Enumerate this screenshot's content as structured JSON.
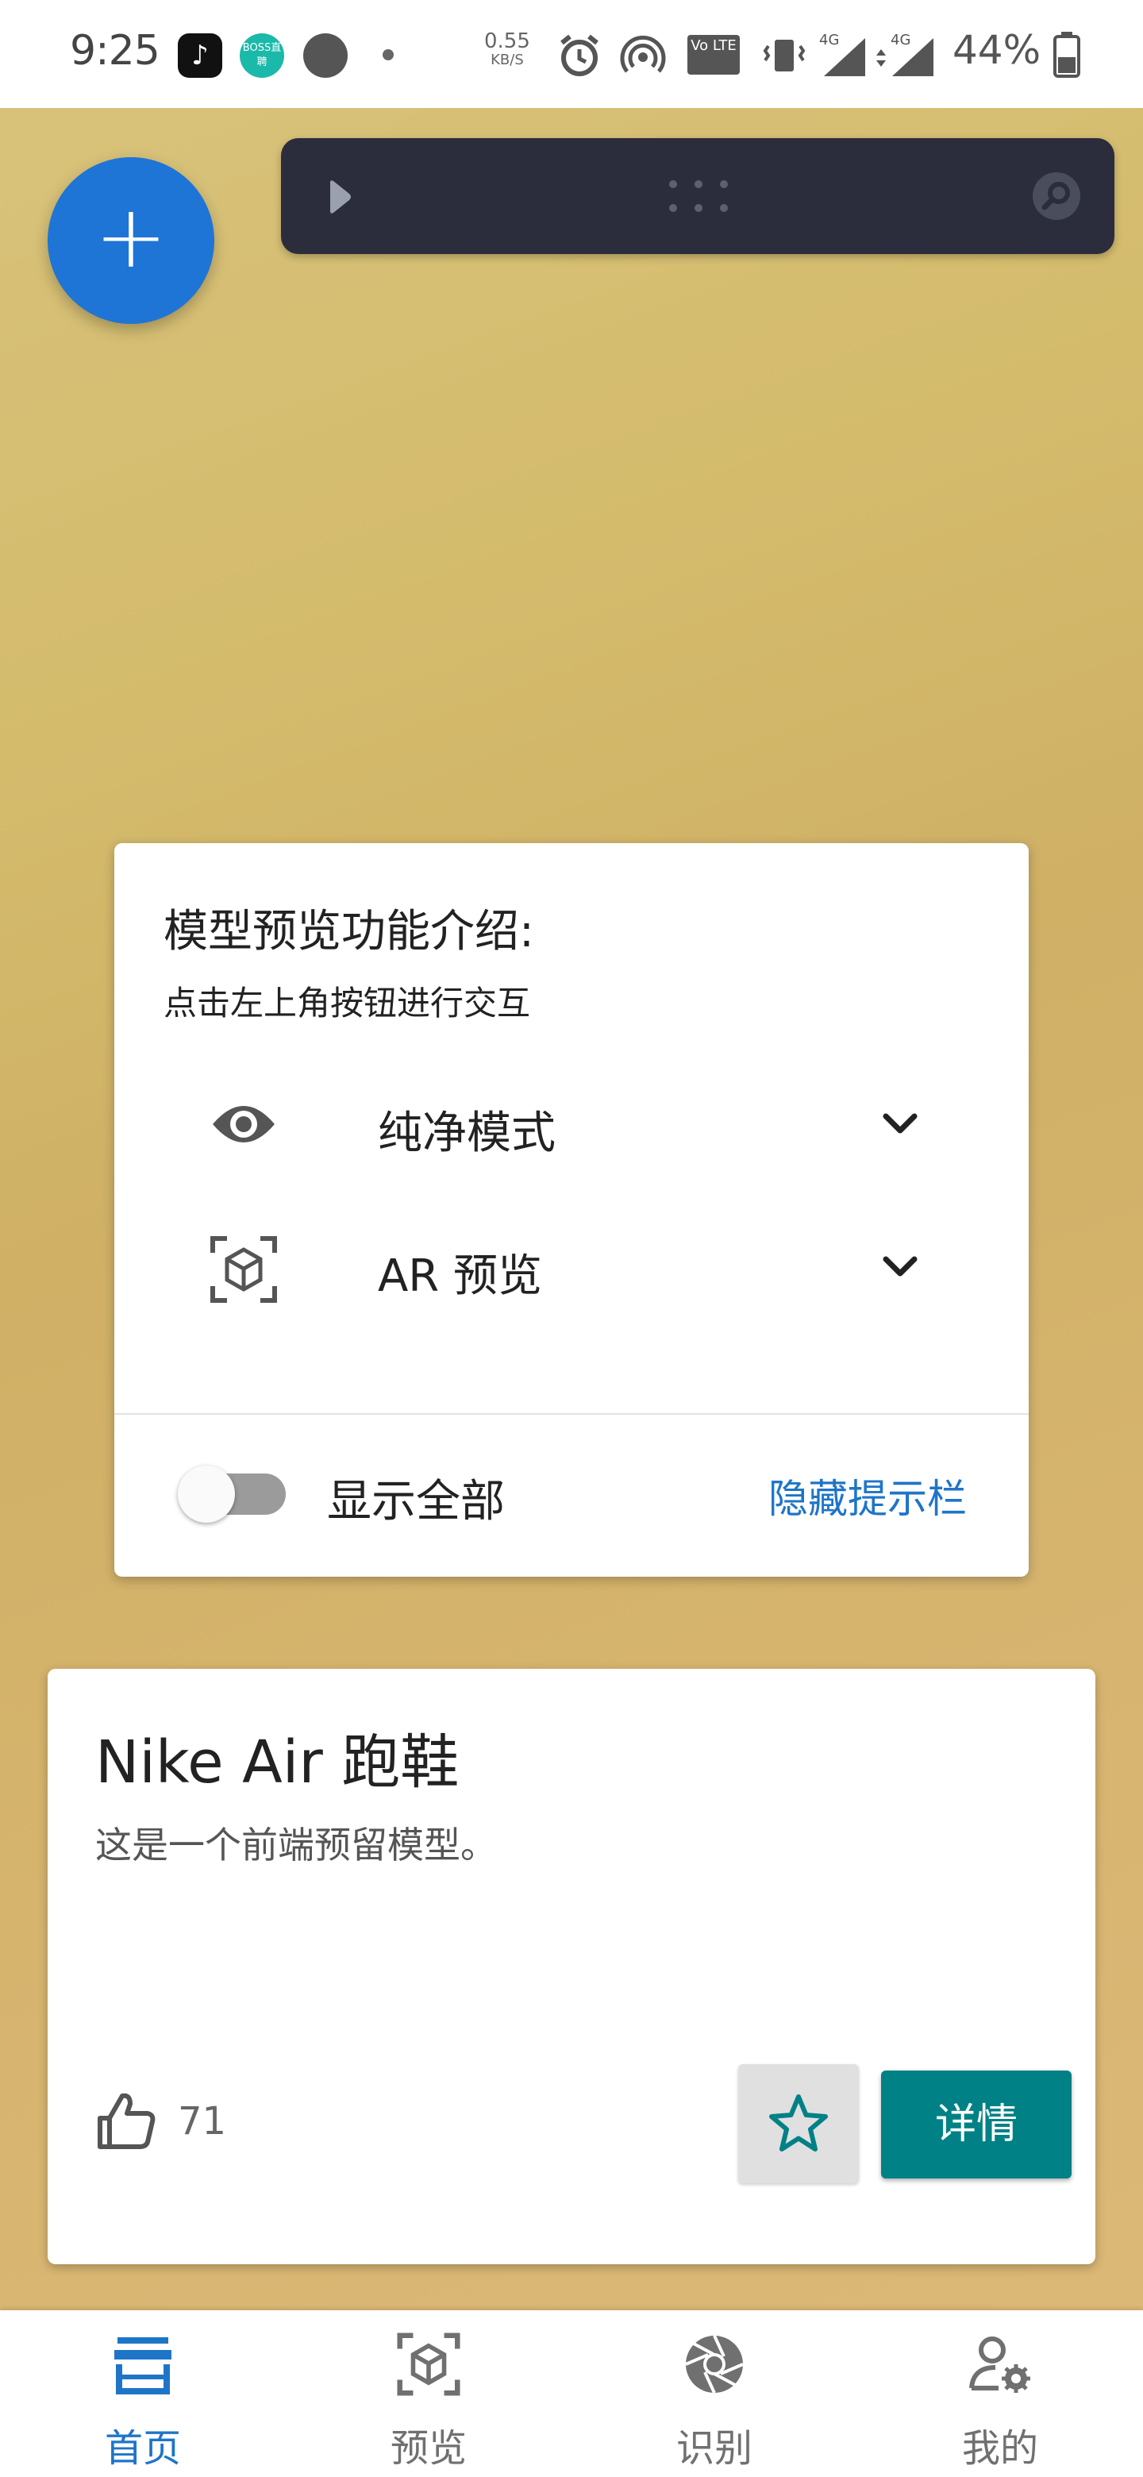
{
  "status_bar": {
    "time": "9:25",
    "tiktok_glyph": "♪",
    "boss_label": "BOSS直聘",
    "net_speed": "0.55",
    "net_unit": "KB/S",
    "volte": "Vo LTE",
    "sim1": "4G",
    "sim2": "4G",
    "battery": "44%"
  },
  "fab": {
    "label": "+"
  },
  "toolbar": {
    "play_icon": "play-icon",
    "handle_icon": "drag-handle-icon",
    "search_icon": "search-icon"
  },
  "intro": {
    "title": "模型预览功能介绍:",
    "subtitle": "点击左上角按钮进行交互",
    "items": [
      {
        "label": "纯净模式",
        "icon": "eye-icon"
      },
      {
        "label": "AR 预览",
        "icon": "cube-scan-icon"
      }
    ],
    "toggle_label": "显示全部",
    "toggle_on": false,
    "hide_link": "隐藏提示栏"
  },
  "product": {
    "title": "Nike Air 跑鞋",
    "description": "这是一个前端预留模型。",
    "likes": "71",
    "detail_button": "详情"
  },
  "bottom_nav": {
    "items": [
      {
        "label": "首页",
        "icon": "store-icon",
        "active": true
      },
      {
        "label": "预览",
        "icon": "cube-scan-icon",
        "active": false
      },
      {
        "label": "识别",
        "icon": "camera-shutter-icon",
        "active": false
      },
      {
        "label": "我的",
        "icon": "user-settings-icon",
        "active": false
      }
    ]
  },
  "colors": {
    "accent": "#1e75c8",
    "fab": "#1e75d6",
    "detail_button": "#008186",
    "toolbar": "#2b2d3d"
  }
}
